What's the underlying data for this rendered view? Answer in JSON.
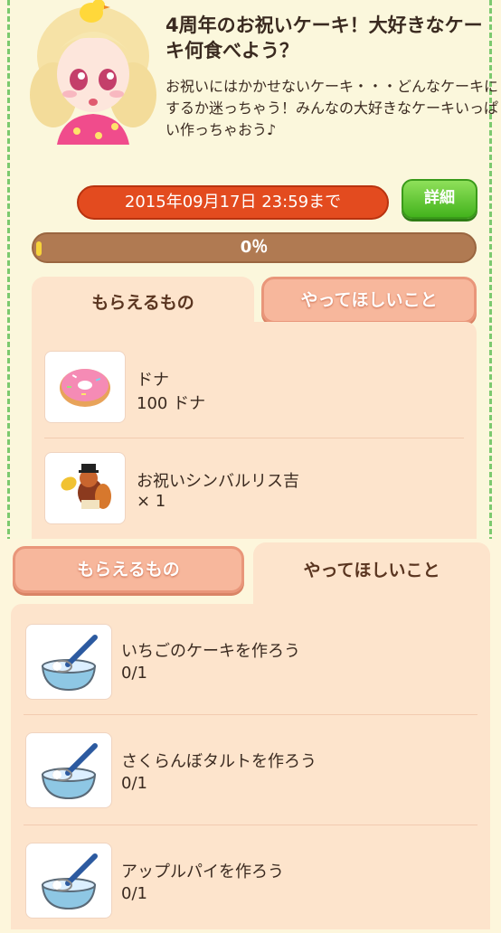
{
  "event": {
    "title": "4周年のお祝いケーキ！大好きなケーキ何食べよう？",
    "description": "お祝いにはかかせないケーキ・・・どんなケーキにするか迷っちゃう！みんなの大好きなケーキいっぱい作っちゃおう♪",
    "deadline": "2015年09月17日 23:59まで",
    "detail_label": "詳細",
    "progress_percent": 0,
    "progress_label": "0％"
  },
  "tabs": {
    "rewards_label": "もらえるもの",
    "tasks_label": "やってほしいこと"
  },
  "rewards": [
    {
      "name": "ドナ",
      "amount": "100 ドナ",
      "icon": "donut-icon"
    },
    {
      "name": "お祝いシンバルリス吉",
      "amount": "× 1",
      "icon": "cymbal-squirrel-icon"
    }
  ],
  "tasks": [
    {
      "name": "いちごのケーキを作ろう",
      "progress": "0/1",
      "icon": "whisk-bowl-icon"
    },
    {
      "name": "さくらんぼタルトを作ろう",
      "progress": "0/1",
      "icon": "whisk-bowl-icon"
    },
    {
      "name": "アップルパイを作ろう",
      "progress": "0/1",
      "icon": "whisk-bowl-icon"
    }
  ],
  "colors": {
    "deadline_bg": "#e34b1f",
    "detail_btn": "#43b31d",
    "progress_track": "#b07a52",
    "panel_bg": "#fde4cc"
  }
}
